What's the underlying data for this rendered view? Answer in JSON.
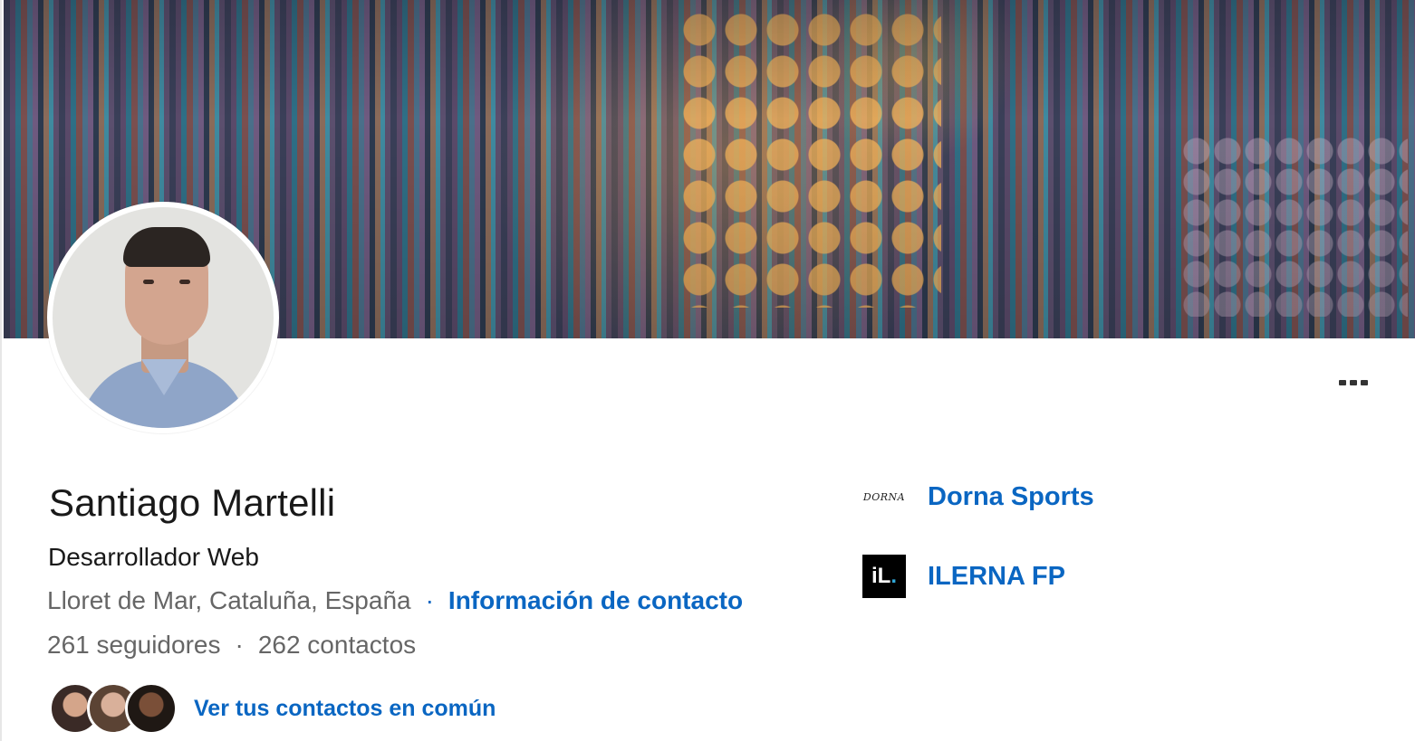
{
  "profile": {
    "name": "Santiago Martelli",
    "headline": "Desarrollador Web",
    "location": "Lloret de Mar, Cataluña, España",
    "separator": "·",
    "contact_info_label": "Información de contacto",
    "followers": "261 seguidores",
    "connections": "262 contactos",
    "mutual_connections_label": "Ver tus contactos en común"
  },
  "experience": [
    {
      "name": "Dorna Sports",
      "logo_text": "DORNA",
      "logo_icon": "dorna-logo"
    },
    {
      "name": "ILERNA FP",
      "logo_text": "iL",
      "logo_accent": ".",
      "logo_icon": "ilerna-logo"
    }
  ],
  "menu": {
    "icon": "more-horizontal-icon"
  },
  "colors": {
    "link": "#0a66c2",
    "text_primary": "#1a1a1a",
    "text_secondary": "#666666",
    "ilerna_accent": "#2fa7d8"
  }
}
